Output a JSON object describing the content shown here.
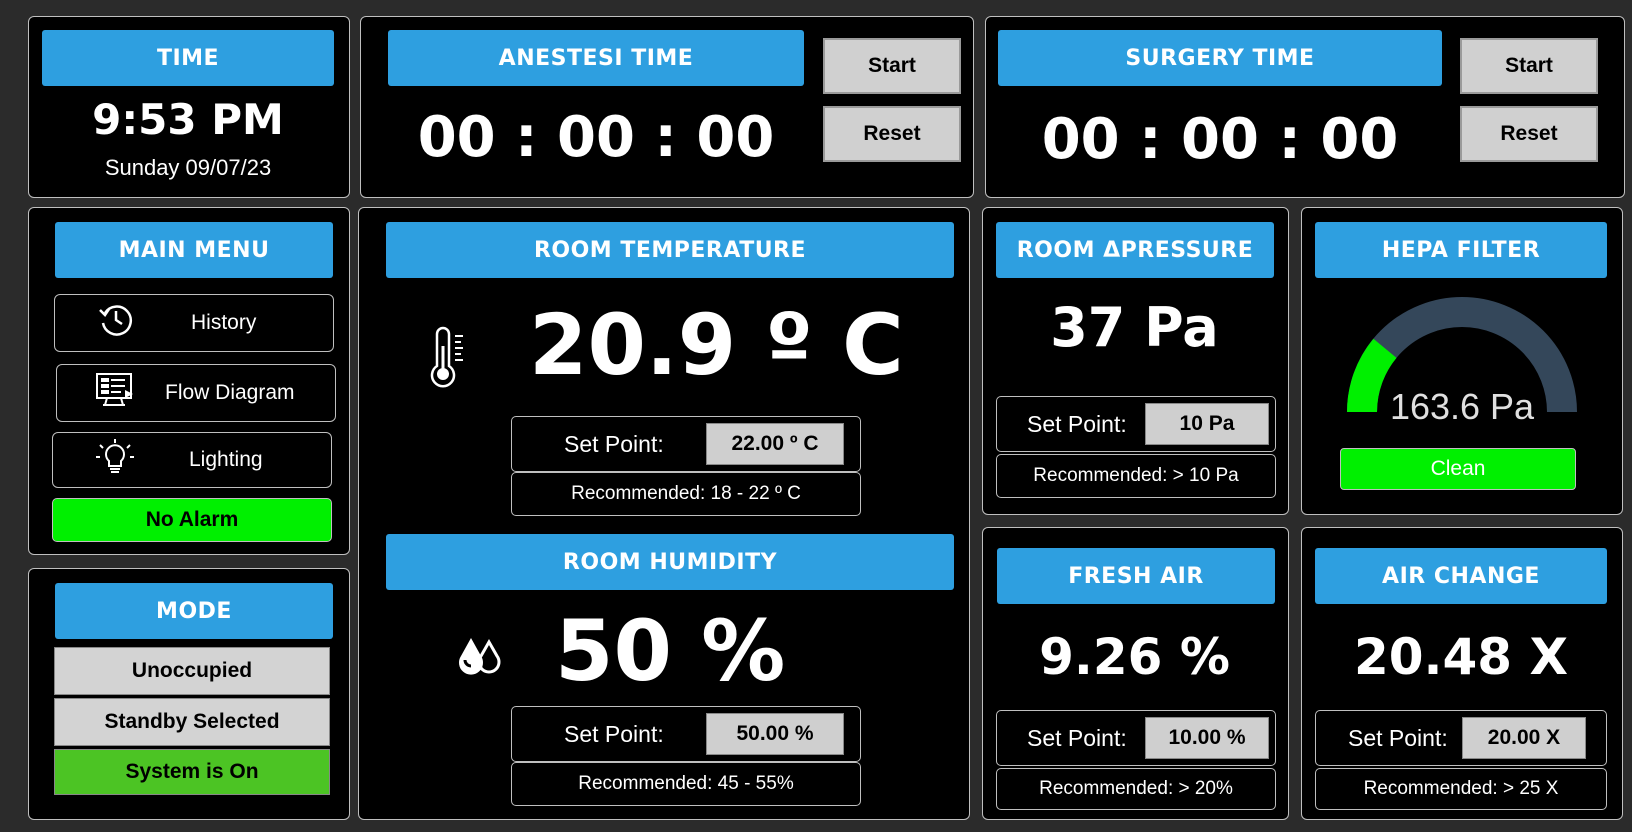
{
  "time": {
    "header": "TIME",
    "clock": "9:53 PM",
    "date": "Sunday 09/07/23"
  },
  "anestesi": {
    "header": "ANESTESI TIME",
    "value": "00 : 00 : 00",
    "start_label": "Start",
    "reset_label": "Reset"
  },
  "surgery": {
    "header": "SURGERY TIME",
    "value": "00 : 00 : 00",
    "start_label": "Start",
    "reset_label": "Reset"
  },
  "main_menu": {
    "header": "MAIN MENU",
    "items": [
      {
        "label": "History",
        "icon": "history-icon"
      },
      {
        "label": "Flow Diagram",
        "icon": "monitor-icon"
      },
      {
        "label": "Lighting",
        "icon": "lightbulb-icon"
      }
    ],
    "alarm_label": "No Alarm"
  },
  "mode": {
    "header": "MODE",
    "buttons": [
      "Unoccupied",
      "Standby Selected",
      "System is On"
    ]
  },
  "temperature": {
    "header": "ROOM TEMPERATURE",
    "value": "20.9 º C",
    "setpoint_label": "Set Point:",
    "setpoint_value": "22.00 º C",
    "recommended": "Recommended: 18 - 22 º C",
    "icon": "thermometer-icon"
  },
  "humidity": {
    "header": "ROOM HUMIDITY",
    "value": "50 %",
    "setpoint_label": "Set Point:",
    "setpoint_value": "50.00 %",
    "recommended": "Recommended: 45 - 55%",
    "icon": "humidity-drops-icon"
  },
  "pressure": {
    "header": "ROOM ΔPRESSURE",
    "value": "37 Pa",
    "setpoint_label": "Set Point:",
    "setpoint_value": "10 Pa",
    "recommended": "Recommended: > 10 Pa"
  },
  "hepa": {
    "header": "HEPA FILTER",
    "gauge_value": "163.6 Pa",
    "gauge_fill_fraction": 0.22,
    "status": "Clean"
  },
  "fresh_air": {
    "header": "FRESH AIR",
    "value": "9.26 %",
    "setpoint_label": "Set Point:",
    "setpoint_value": "10.00 %",
    "recommended": "Recommended: > 20%"
  },
  "air_change": {
    "header": "AIR CHANGE",
    "value": "20.48 X",
    "setpoint_label": "Set Point:",
    "setpoint_value": "20.00 X",
    "recommended": "Recommended: > 25 X"
  },
  "colors": {
    "header_blue": "#2e9fe0",
    "ok_green": "#00f000",
    "system_green": "#4cc424",
    "gauge_track": "#34475a"
  }
}
